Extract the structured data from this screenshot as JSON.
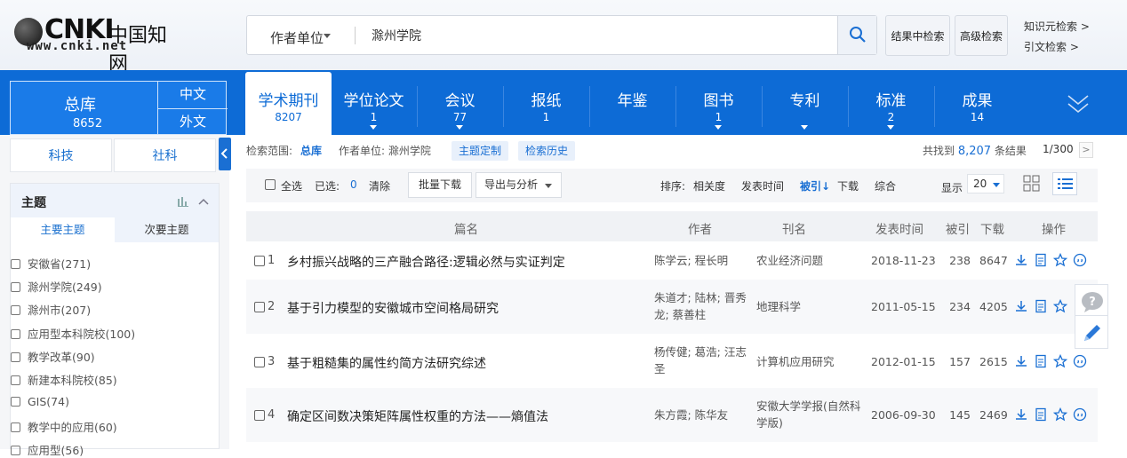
{
  "logo": {
    "cn": "中国知网",
    "latin": "CNKI",
    "url": "www.cnki.net"
  },
  "search": {
    "field": "作者单位",
    "value": "滁州学院"
  },
  "header_buttons": {
    "in_result": "结果中检索",
    "advanced": "高级检索"
  },
  "header_links": {
    "knowledge": "知识元检索 >",
    "citation": "引文检索 >"
  },
  "total_db": {
    "label": "总库",
    "count": "8652",
    "zh": "中文",
    "foreign": "外文"
  },
  "tabs": [
    {
      "label": "学术期刊",
      "count": "8207"
    },
    {
      "label": "学位论文",
      "count": "1"
    },
    {
      "label": "会议",
      "count": "77"
    },
    {
      "label": "报纸",
      "count": "1"
    },
    {
      "label": "年鉴",
      "count": ""
    },
    {
      "label": "图书",
      "count": "1"
    },
    {
      "label": "专利",
      "count": ""
    },
    {
      "label": "标准",
      "count": "2"
    },
    {
      "label": "成果",
      "count": "14"
    }
  ],
  "sidebar": {
    "tabs": [
      "科技",
      "社科"
    ],
    "group_title": "主题",
    "subtabs": [
      "主要主题",
      "次要主题"
    ],
    "items": [
      "安徽省(271)",
      "滁州学院(249)",
      "滁州市(207)",
      "应用型本科院校(100)",
      "教学改革(90)",
      "新建本科院校(85)",
      "GIS(74)",
      "教学中的应用(60)",
      "应用型(56)"
    ]
  },
  "filter_bar": {
    "scope_label": "检索范围:",
    "scope_value": "总库",
    "condition": "作者单位: 滁州学院",
    "tag1": "主题定制",
    "tag2": "检索历史",
    "total_prefix": "共找到",
    "total": "8,207",
    "total_suffix": "条结果",
    "page": "1/300",
    "next": ">"
  },
  "toolbar": {
    "select_all": "全选",
    "selected_label": "已选:",
    "selected_count": "0",
    "clear": "清除",
    "batch_download": "批量下载",
    "export": "导出与分析",
    "sort_label": "排序:",
    "sort_relevance": "相关度",
    "sort_date": "发表时间",
    "sort_cited": "被引",
    "sort_download": "下载",
    "sort_overall": "综合",
    "display_label": "显示",
    "display_value": "20"
  },
  "table": {
    "headers": [
      "篇名",
      "作者",
      "刊名",
      "发表时间",
      "被引",
      "下载",
      "操作"
    ],
    "rows": [
      {
        "no": "1",
        "title": "乡村振兴战略的三产融合路径:逻辑必然与实证判定",
        "authors": "陈学云; 程长明",
        "source": "农业经济问题",
        "date": "2018-11-23",
        "cited": "238",
        "downloads": "8647"
      },
      {
        "no": "2",
        "title": "基于引力模型的安徽城市空间格局研究",
        "authors": "朱道才; 陆林; 晋秀龙; 蔡善柱",
        "source": "地理科学",
        "date": "2011-05-15",
        "cited": "234",
        "downloads": "4205"
      },
      {
        "no": "3",
        "title": "基于粗糙集的属性约简方法研究综述",
        "authors": "杨传健; 葛浩; 汪志圣",
        "source": "计算机应用研究",
        "date": "2012-01-15",
        "cited": "157",
        "downloads": "2615"
      },
      {
        "no": "4",
        "title": "确定区间数决策矩阵属性权重的方法——熵值法",
        "authors": "朱方霞; 陈华友",
        "source": "安徽大学学报(自然科学版)",
        "date": "2006-09-30",
        "cited": "145",
        "downloads": "2469"
      }
    ]
  },
  "colors": {
    "primary": "#0d6bd6",
    "link": "#1a6fd3"
  }
}
